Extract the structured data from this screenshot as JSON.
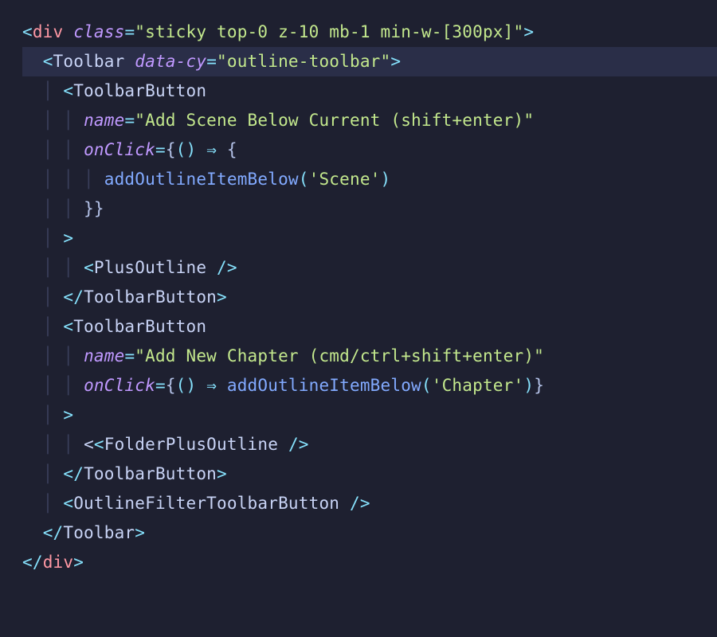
{
  "code": {
    "l1": {
      "open": "<",
      "tag": "div",
      "sp": " ",
      "a1": "class",
      "eq": "=",
      "q": "\"",
      "v1": "sticky top-0 z-10 mb-1 min-w-[300px]",
      "close": ">"
    },
    "l2": {
      "ind": "  ",
      "open": "<",
      "comp": "Toolbar",
      "sp": " ",
      "a1": "data-cy",
      "eq": "=",
      "q": "\"",
      "v1": "outline-toolbar",
      "close": ">"
    },
    "l3": {
      "ind": "    ",
      "open": "<",
      "comp": "ToolbarButton"
    },
    "l4": {
      "ind": "      ",
      "a1": "name",
      "eq": "=",
      "q": "\"",
      "v1": "Add Scene Below Current (shift+enter)"
    },
    "l5": {
      "ind": "      ",
      "a1": "onClick",
      "eq": "=",
      "ob": "{",
      "lp": "(",
      "rp": ")",
      "sp": " ",
      "arrow": "⇒",
      "sp2": " ",
      "ob2": "{"
    },
    "l6": {
      "ind": "        ",
      "fn": "addOutlineItemBelow",
      "lp": "(",
      "sq": "'",
      "arg": "Scene",
      "rp": ")"
    },
    "l7": {
      "ind": "      ",
      "cb": "}",
      "cb2": "}"
    },
    "l8": {
      "ind": "    ",
      "close": ">"
    },
    "l9": {
      "ind": "      ",
      "open": "<",
      "comp": "PlusOutline",
      "sp": " ",
      "slash": "/",
      "close": ">"
    },
    "l10": {
      "ind": "    ",
      "open": "<",
      "slash": "/",
      "comp": "ToolbarButton",
      "close": ">"
    },
    "l11": {
      "ind": "    ",
      "open": "<",
      "comp": "ToolbarButton"
    },
    "l12": {
      "ind": "      ",
      "a1": "name",
      "eq": "=",
      "q": "\"",
      "v1": "Add New Chapter (cmd/ctrl+shift+enter)"
    },
    "l13": {
      "ind": "      ",
      "a1": "onClick",
      "eq": "=",
      "ob": "{",
      "lp": "(",
      "rp": ")",
      "sp": " ",
      "arrow": "⇒",
      "sp2": " ",
      "fn": "addOutlineItemBelow",
      "lp2": "(",
      "sq": "'",
      "arg": "Chapter",
      "rp2": ")",
      "cb": "}"
    },
    "l14": {
      "ind": "    ",
      "close": ">"
    },
    "l15": {
      "ind": "      ",
      "open": "<",
      "comp": "FolderPlusOutline",
      "sp": " ",
      "slash": "/",
      "close": ">"
    },
    "l16": {
      "ind": "    ",
      "open": "<",
      "slash": "/",
      "comp": "ToolbarButton",
      "close": ">"
    },
    "l17": {
      "ind": "    ",
      "open": "<",
      "comp": "OutlineFilterToolbarButton",
      "sp": " ",
      "slash": "/",
      "close": ">"
    },
    "l18": {
      "ind": "  ",
      "open": "<",
      "slash": "/",
      "comp": "Toolbar",
      "close": ">"
    },
    "l19": {
      "open": "<",
      "slash": "/",
      "tag": "div",
      "close": ">"
    }
  }
}
